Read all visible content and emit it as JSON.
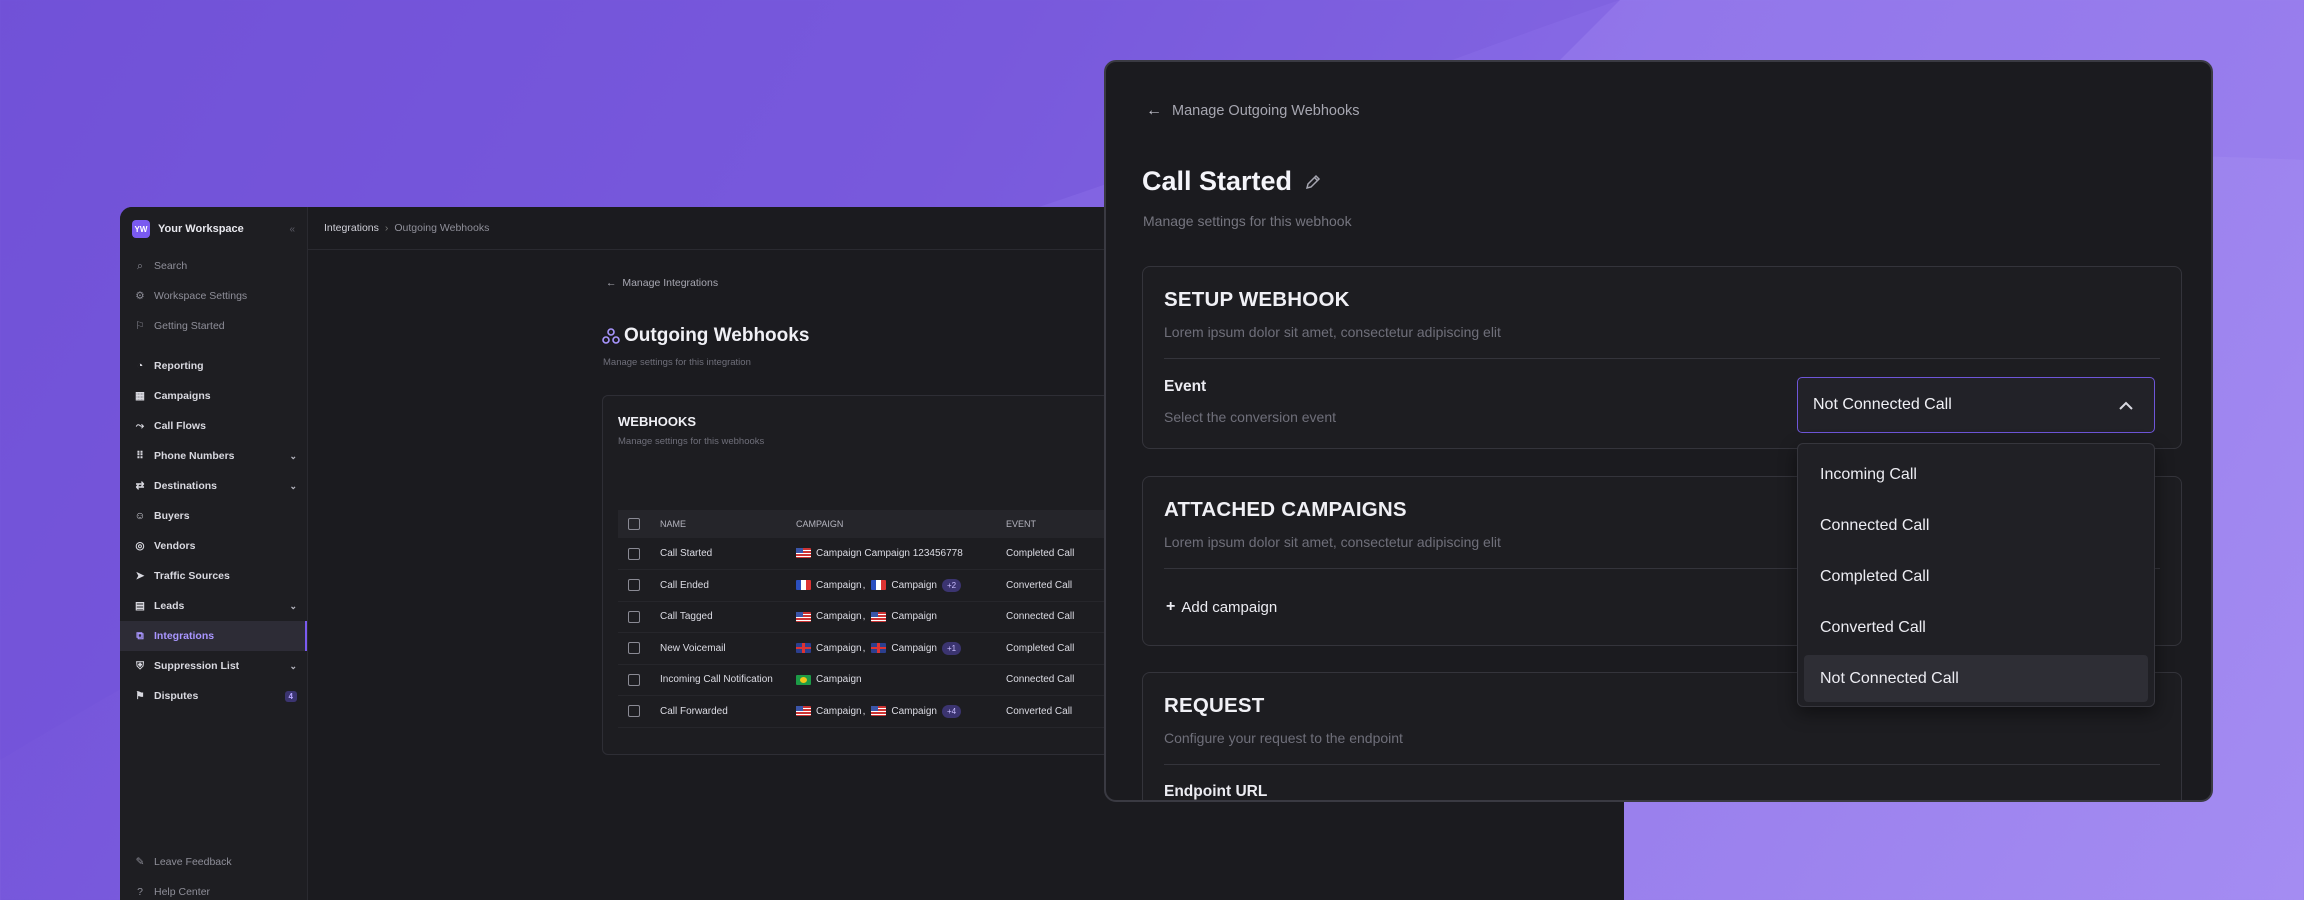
{
  "back_window": {
    "workspace": {
      "avatar": "YW",
      "name": "Your Workspace"
    },
    "sidebar_top": [
      {
        "label": "Search",
        "icon": "search-icon"
      },
      {
        "label": "Workspace Settings",
        "icon": "gear-icon"
      },
      {
        "label": "Getting Started",
        "icon": "rocket-icon"
      }
    ],
    "sidebar_main": [
      {
        "label": "Reporting",
        "icon": "chart-icon"
      },
      {
        "label": "Campaigns",
        "icon": "grid-icon"
      },
      {
        "label": "Call Flows",
        "icon": "flow-icon"
      },
      {
        "label": "Phone Numbers",
        "icon": "keypad-icon",
        "chevron": true
      },
      {
        "label": "Destinations",
        "icon": "route-icon",
        "chevron": true
      },
      {
        "label": "Buyers",
        "icon": "users-icon"
      },
      {
        "label": "Vendors",
        "icon": "vendor-icon"
      },
      {
        "label": "Traffic Sources",
        "icon": "send-icon"
      },
      {
        "label": "Leads",
        "icon": "leads-icon",
        "chevron": true
      },
      {
        "label": "Integrations",
        "icon": "integrations-icon",
        "active": true
      },
      {
        "label": "Suppression List",
        "icon": "shield-icon",
        "chevron": true
      },
      {
        "label": "Disputes",
        "icon": "flag-icon",
        "badge": "4"
      }
    ],
    "sidebar_bottom": [
      {
        "label": "Leave Feedback",
        "icon": "feedback-icon"
      },
      {
        "label": "Help Center",
        "icon": "help-icon"
      }
    ],
    "breadcrumb": {
      "parent": "Integrations",
      "current": "Outgoing Webhooks"
    },
    "back_link": "Manage Integrations",
    "page_title": "Outgoing Webhooks",
    "page_subtitle": "Manage settings for this integration",
    "card": {
      "title": "WEBHOOKS",
      "subtitle": "Manage settings for this webhooks",
      "columns": [
        "NAME",
        "CAMPAIGN",
        "EVENT"
      ],
      "rows": [
        {
          "name": "Call Started",
          "campaigns": [
            {
              "flag": "us",
              "text": "Campaign Campaign 123456778"
            }
          ],
          "more": "",
          "event": "Completed Call"
        },
        {
          "name": "Call Ended",
          "campaigns": [
            {
              "flag": "fr",
              "text": "Campaign"
            },
            {
              "flag": "fr",
              "text": "Campaign"
            }
          ],
          "more": "+2",
          "event": "Converted Call"
        },
        {
          "name": "Call Tagged",
          "campaigns": [
            {
              "flag": "us",
              "text": "Campaign"
            },
            {
              "flag": "us",
              "text": "Campaign"
            }
          ],
          "more": "",
          "event": "Connected Call"
        },
        {
          "name": "New Voicemail",
          "campaigns": [
            {
              "flag": "uk",
              "text": "Campaign"
            },
            {
              "flag": "uk",
              "text": "Campaign"
            }
          ],
          "more": "+1",
          "event": "Completed Call"
        },
        {
          "name": "Incoming Call Notification",
          "campaigns": [
            {
              "flag": "br",
              "text": "Campaign"
            }
          ],
          "more": "",
          "event": "Connected Call"
        },
        {
          "name": "Call Forwarded",
          "campaigns": [
            {
              "flag": "us",
              "text": "Campaign"
            },
            {
              "flag": "us",
              "text": "Campaign"
            }
          ],
          "more": "+4",
          "event": "Converted Call"
        }
      ]
    }
  },
  "front_window": {
    "back_link": "Manage Outgoing Webhooks",
    "title": "Call Started",
    "subtitle": "Manage settings for this webhook",
    "setup": {
      "title": "SETUP WEBHOOK",
      "subtitle": "Lorem ipsum dolor sit amet, consectetur adipiscing elit",
      "event_label": "Event",
      "event_sub": "Select the conversion event",
      "selected": "Not Connected Call"
    },
    "attached": {
      "title": "ATTACHED CAMPAIGNS",
      "subtitle": "Lorem ipsum dolor sit amet, consectetur adipiscing elit",
      "add_label": "Add campaign"
    },
    "request": {
      "title": "REQUEST",
      "subtitle": "Configure your request to the endpoint",
      "endpoint_label": "Endpoint URL"
    },
    "dropdown_options": [
      "Incoming Call",
      "Connected Call",
      "Completed Call",
      "Converted Call",
      "Not Connected Call"
    ],
    "dropdown_selected_index": 4
  },
  "colors": {
    "accent": "#7a5af0",
    "bg_dark": "#1b1b1f",
    "backdrop": "#8a6ce6"
  }
}
